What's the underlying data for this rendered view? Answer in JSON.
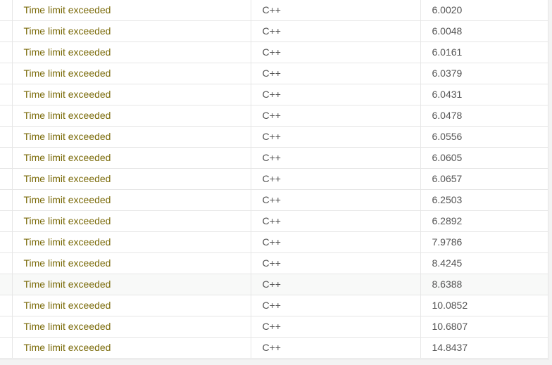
{
  "table": {
    "hover_row": 13,
    "rows": [
      {
        "status": "Time limit exceeded",
        "language": "C++",
        "time": "6.0020"
      },
      {
        "status": "Time limit exceeded",
        "language": "C++",
        "time": "6.0048"
      },
      {
        "status": "Time limit exceeded",
        "language": "C++",
        "time": "6.0161"
      },
      {
        "status": "Time limit exceeded",
        "language": "C++",
        "time": "6.0379"
      },
      {
        "status": "Time limit exceeded",
        "language": "C++",
        "time": "6.0431"
      },
      {
        "status": "Time limit exceeded",
        "language": "C++",
        "time": "6.0478"
      },
      {
        "status": "Time limit exceeded",
        "language": "C++",
        "time": "6.0556"
      },
      {
        "status": "Time limit exceeded",
        "language": "C++",
        "time": "6.0605"
      },
      {
        "status": "Time limit exceeded",
        "language": "C++",
        "time": "6.0657"
      },
      {
        "status": "Time limit exceeded",
        "language": "C++",
        "time": "6.2503"
      },
      {
        "status": "Time limit exceeded",
        "language": "C++",
        "time": "6.2892"
      },
      {
        "status": "Time limit exceeded",
        "language": "C++",
        "time": "7.9786"
      },
      {
        "status": "Time limit exceeded",
        "language": "C++",
        "time": "8.4245"
      },
      {
        "status": "Time limit exceeded",
        "language": "C++",
        "time": "8.6388"
      },
      {
        "status": "Time limit exceeded",
        "language": "C++",
        "time": "10.0852"
      },
      {
        "status": "Time limit exceeded",
        "language": "C++",
        "time": "10.6807"
      },
      {
        "status": "Time limit exceeded",
        "language": "C++",
        "time": "14.8437"
      }
    ]
  },
  "colors": {
    "status_text": "#7a6a08",
    "cell_text": "#555555",
    "border": "#e6e6e6",
    "hover_bg": "#f8f9f8"
  }
}
